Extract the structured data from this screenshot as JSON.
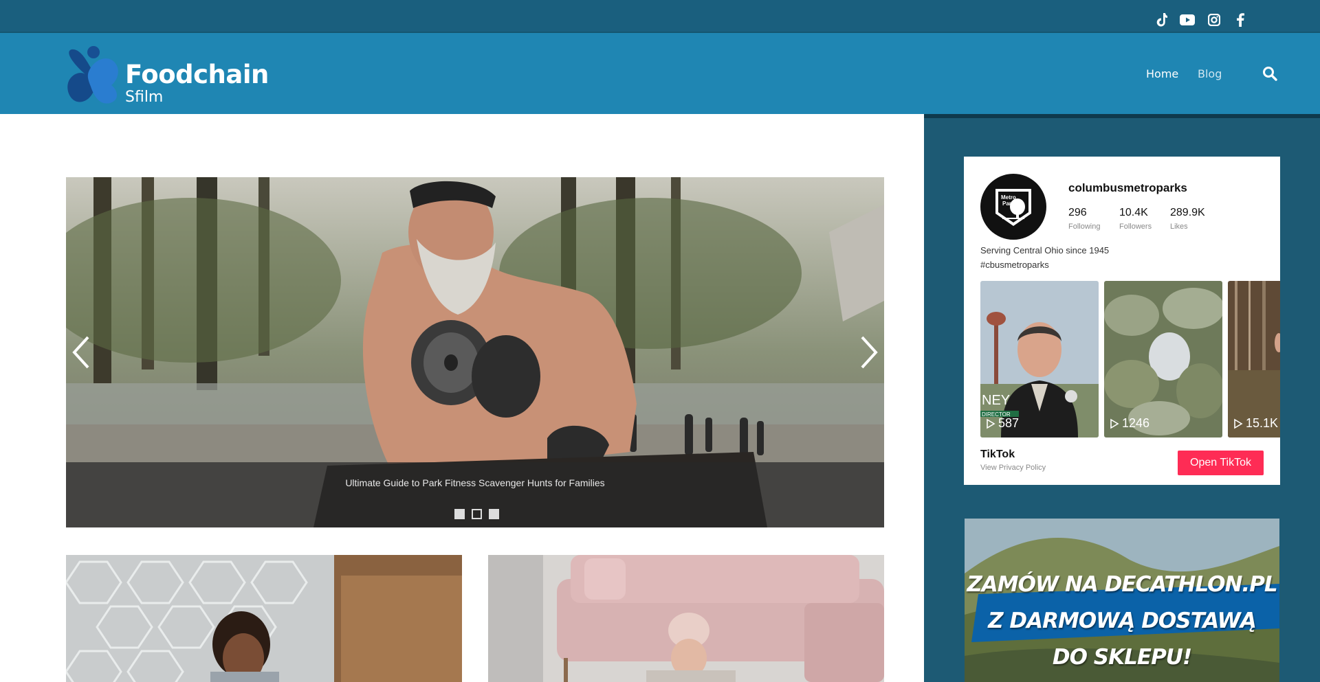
{
  "social": {
    "icons": [
      "tiktok-icon",
      "youtube-icon",
      "instagram-icon",
      "facebook-icon"
    ]
  },
  "header": {
    "logo_title": "Foodchain",
    "logo_subtitle": "Sfilm",
    "nav": [
      "Home",
      "Blog"
    ],
    "search_icon": "search-icon"
  },
  "slider": {
    "caption": "Ultimate Guide to Park Fitness Scavenger Hunts for Families",
    "slide_count": 3,
    "active_slide": 2,
    "prev_icon": "chevron-left-icon",
    "next_icon": "chevron-right-icon"
  },
  "tiktok": {
    "username": "columbusmetroparks",
    "stats": [
      {
        "value": "296",
        "label": "Following"
      },
      {
        "value": "10.4K",
        "label": "Followers"
      },
      {
        "value": "289.9K",
        "label": "Likes"
      }
    ],
    "bio_line1": "Serving Central Ohio since 1945",
    "bio_line2": "#cbusmetroparks",
    "avatar_text_1": "Metro",
    "avatar_text_2": "Parks",
    "videos": [
      {
        "views": "587",
        "overlay_name": "NEY",
        "overlay_role": "DIRECTOR"
      },
      {
        "views": "1246"
      },
      {
        "views": "15.1K"
      }
    ],
    "brand": "TikTok",
    "privacy": "View Privacy Policy",
    "open_button": "Open TikTok"
  },
  "ad": {
    "line1": "ZAMÓW NA DECATHLON.PL",
    "line2": "Z DARMOWĄ DOSTAWĄ",
    "line3": "DO SKLEPU!"
  },
  "colors": {
    "topbar": "#1a5f7e",
    "header": "#1f86b3",
    "sidebar": "#1d5a74",
    "tiktok_button": "#fe2c55"
  }
}
